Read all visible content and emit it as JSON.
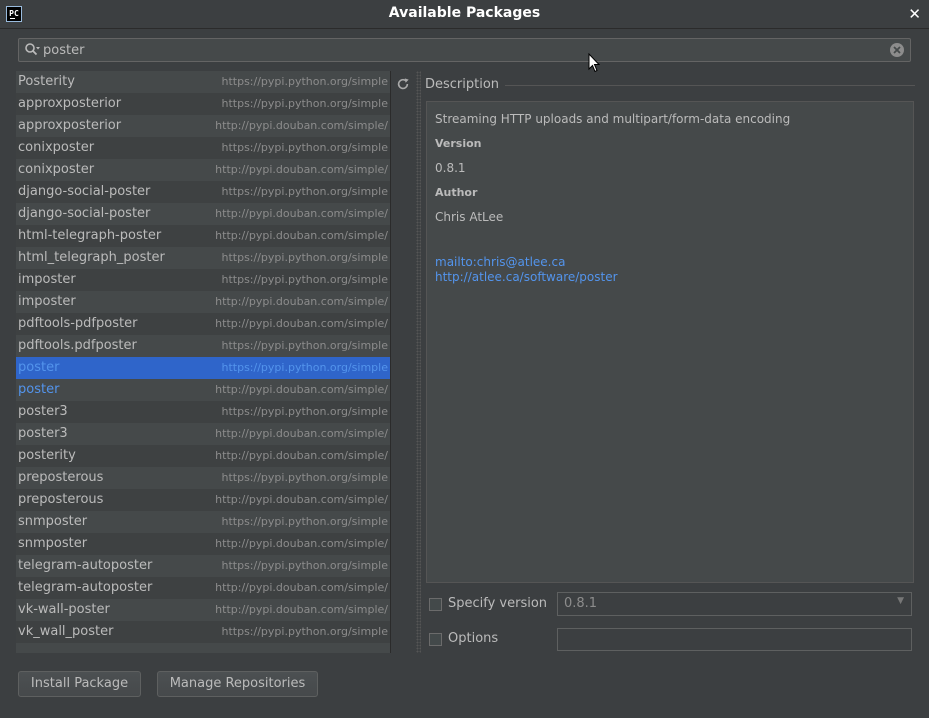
{
  "window": {
    "title": "Available Packages",
    "app_icon_text": "PC"
  },
  "search": {
    "value": "poster",
    "placeholder": ""
  },
  "packages": [
    {
      "name": "Posterity",
      "repo": "https://pypi.python.org/simple"
    },
    {
      "name": "approxposterior",
      "repo": "https://pypi.python.org/simple"
    },
    {
      "name": "approxposterior",
      "repo": "http://pypi.douban.com/simple/"
    },
    {
      "name": "conixposter",
      "repo": "https://pypi.python.org/simple"
    },
    {
      "name": "conixposter",
      "repo": "http://pypi.douban.com/simple/"
    },
    {
      "name": "django-social-poster",
      "repo": "https://pypi.python.org/simple"
    },
    {
      "name": "django-social-poster",
      "repo": "http://pypi.douban.com/simple/"
    },
    {
      "name": "html-telegraph-poster",
      "repo": "http://pypi.douban.com/simple/"
    },
    {
      "name": "html_telegraph_poster",
      "repo": "https://pypi.python.org/simple"
    },
    {
      "name": "imposter",
      "repo": "https://pypi.python.org/simple"
    },
    {
      "name": "imposter",
      "repo": "http://pypi.douban.com/simple/"
    },
    {
      "name": "pdftools-pdfposter",
      "repo": "http://pypi.douban.com/simple/"
    },
    {
      "name": "pdftools.pdfposter",
      "repo": "https://pypi.python.org/simple"
    },
    {
      "name": "poster",
      "repo": "https://pypi.python.org/simple"
    },
    {
      "name": "poster",
      "repo": "http://pypi.douban.com/simple/"
    },
    {
      "name": "poster3",
      "repo": "https://pypi.python.org/simple"
    },
    {
      "name": "poster3",
      "repo": "http://pypi.douban.com/simple/"
    },
    {
      "name": "posterity",
      "repo": "http://pypi.douban.com/simple/"
    },
    {
      "name": "preposterous",
      "repo": "https://pypi.python.org/simple"
    },
    {
      "name": "preposterous",
      "repo": "http://pypi.douban.com/simple/"
    },
    {
      "name": "snmposter",
      "repo": "https://pypi.python.org/simple"
    },
    {
      "name": "snmposter",
      "repo": "http://pypi.douban.com/simple/"
    },
    {
      "name": "telegram-autoposter",
      "repo": "https://pypi.python.org/simple"
    },
    {
      "name": "telegram-autoposter",
      "repo": "http://pypi.douban.com/simple/"
    },
    {
      "name": "vk-wall-poster",
      "repo": "http://pypi.douban.com/simple/"
    },
    {
      "name": "vk_wall_poster",
      "repo": "https://pypi.python.org/simple"
    }
  ],
  "selected_package_index": 13,
  "installed_package_indices": [
    13,
    14
  ],
  "description": {
    "section_label": "Description",
    "summary": "Streaming HTTP uploads and multipart/form-data encoding",
    "version_label": "Version",
    "version_value": "0.8.1",
    "author_label": "Author",
    "author_value": "Chris AtLee",
    "link_email": "mailto:chris@atlee.ca",
    "link_homepage": "http://atlee.ca/software/poster"
  },
  "options": {
    "specify_version_label": "Specify version",
    "specify_version_checked": false,
    "version_selected": "0.8.1",
    "options_label": "Options",
    "options_checked": false,
    "options_value": ""
  },
  "buttons": {
    "install": "Install Package",
    "manage_repos": "Manage Repositories"
  },
  "icons": {
    "search": "search-icon",
    "clear": "clear-search-icon",
    "refresh": "refresh-icon",
    "close": "close-icon",
    "dropdown": "chevron-down-icon"
  },
  "colors": {
    "background": "#3c3f41",
    "panel": "#45494a",
    "selection": "#2f65ca",
    "link": "#5394ec",
    "text": "#bbbbbb"
  }
}
